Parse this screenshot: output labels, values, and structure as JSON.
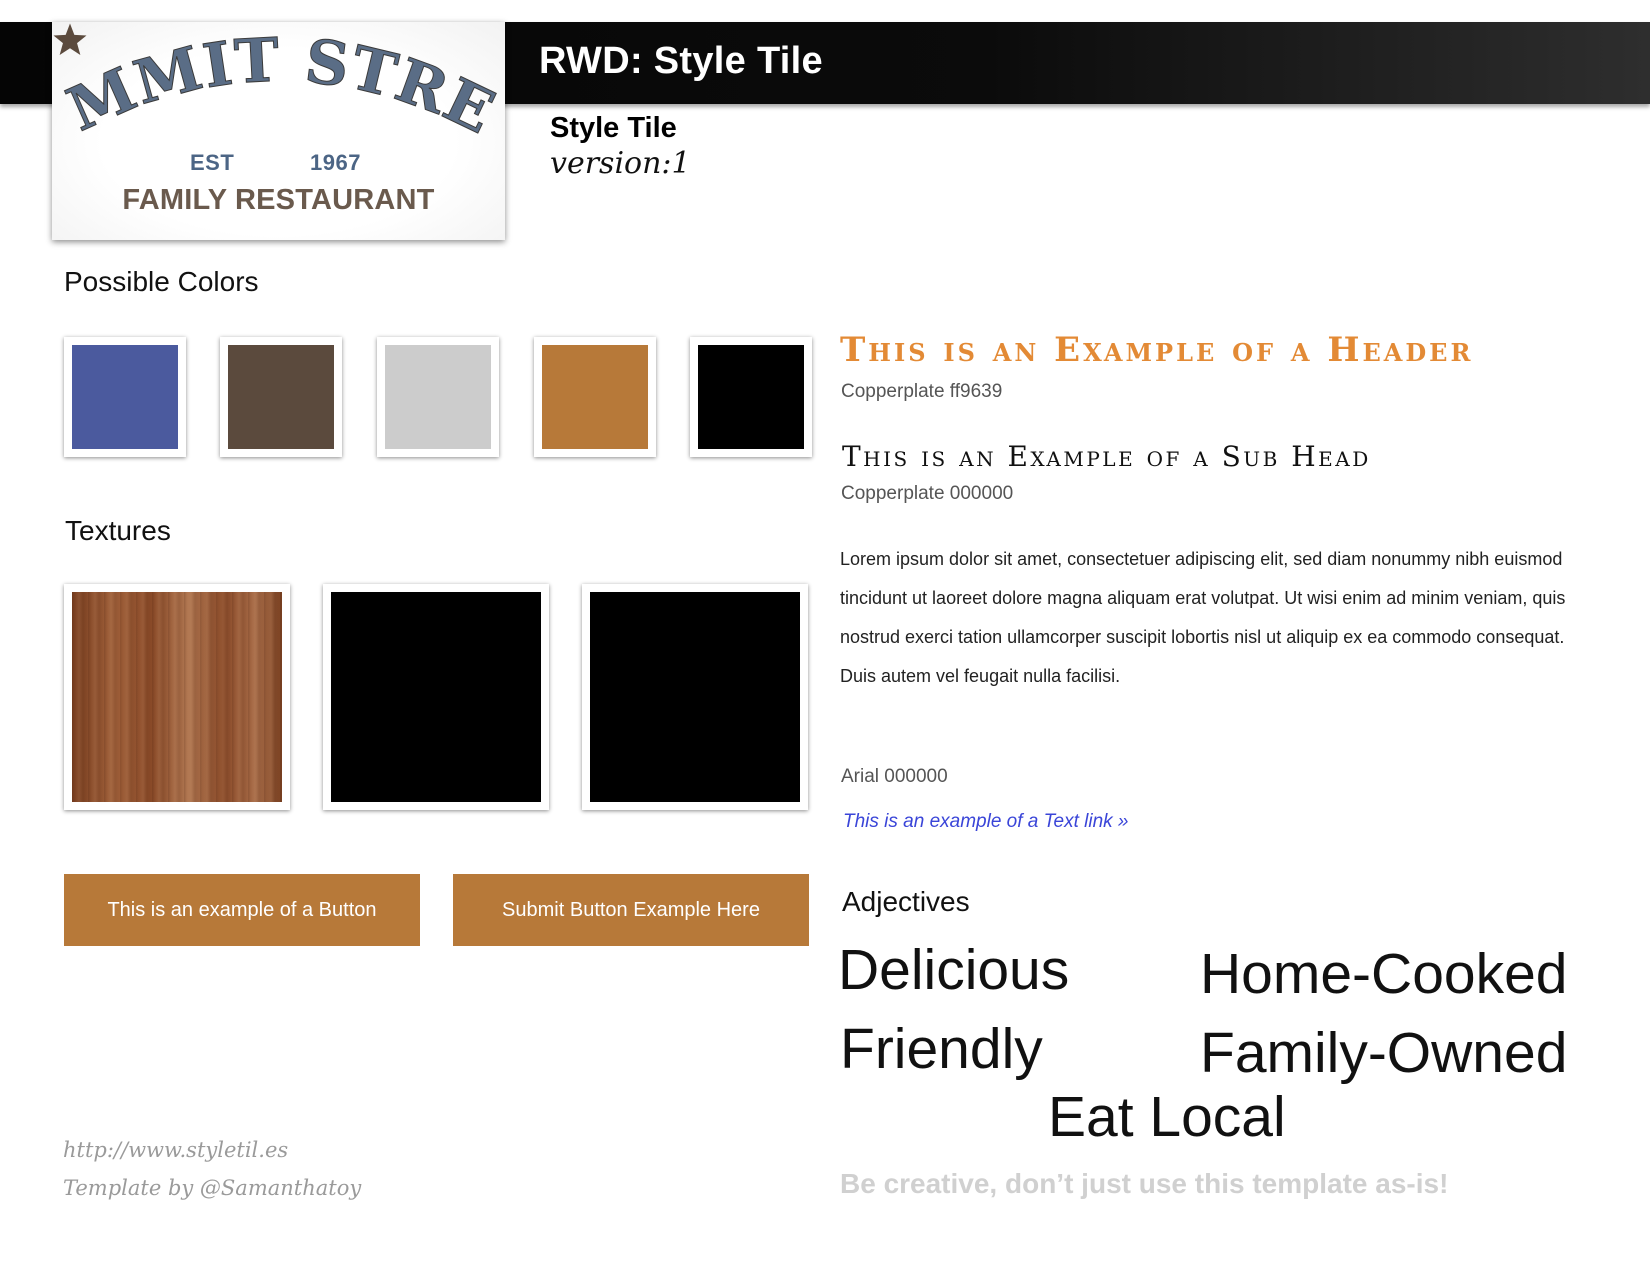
{
  "header": {
    "title": "RWD: Style Tile"
  },
  "logo": {
    "arc_text": "SUMMIT STREET",
    "est": "EST",
    "year": "1967",
    "subtitle": "FAMILY RESTAURANT",
    "icon": "star-icon"
  },
  "tile": {
    "name": "Style Tile",
    "version": "version:1"
  },
  "colors": {
    "heading": "Possible Colors",
    "swatches": [
      "#4b5a9e",
      "#5b4a3d",
      "#cccccc",
      "#b77939",
      "#000000"
    ]
  },
  "textures": {
    "heading": "Textures",
    "items": [
      "wood",
      "black",
      "black"
    ]
  },
  "buttons": {
    "example": "This is an example of a Button",
    "submit": "Submit Button Example Here",
    "color": "#b77939"
  },
  "typography": {
    "header_example": "This is an Example of a Header",
    "header_caption": "Copperplate ff9639",
    "header_color": "#ff9639",
    "subhead_example": "This is an Example of a Sub Head",
    "subhead_caption": "Copperplate 000000",
    "body": "Lorem ipsum dolor sit amet, consectetuer adipiscing elit, sed diam nonummy nibh euismod tincidunt ut laoreet dolore magna aliquam erat volutpat. Ut wisi enim ad minim veniam, quis nostrud exerci tation ullamcorper suscipit lobortis nisl ut aliquip ex ea commodo consequat. Duis autem vel feugait nulla facilisi.",
    "body_caption": "Arial 000000",
    "link": "This is an example of a Text link »"
  },
  "adjectives": {
    "heading": "Adjectives",
    "words": [
      "Delicious",
      "Home-Cooked",
      "Friendly",
      "Family-Owned",
      "Eat Local"
    ]
  },
  "footer": {
    "url": "http://www.styletil.es",
    "credit": "Template by @Samanthatoy",
    "tagline": "Be creative, don’t just use this template as-is!"
  }
}
